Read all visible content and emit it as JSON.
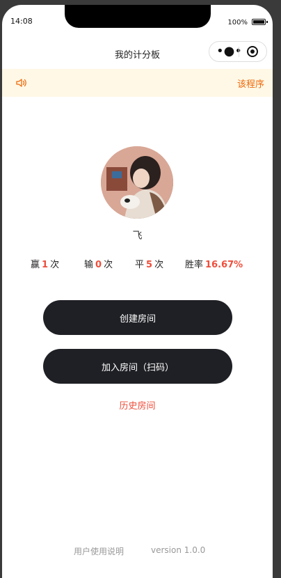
{
  "status_bar": {
    "time": "14:08",
    "battery_percent": "100%"
  },
  "nav": {
    "title": "我的计分板",
    "more_icon": "•●•",
    "close_icon": "record-icon"
  },
  "notice": {
    "text": "该程序",
    "icon": "speaker-icon",
    "color": "#ed6a0c"
  },
  "profile": {
    "username": "飞",
    "stats": [
      {
        "label": "赢",
        "value": "1",
        "suffix": "次"
      },
      {
        "label": "输",
        "value": "0",
        "suffix": "次"
      },
      {
        "label": "平",
        "value": "5",
        "suffix": "次"
      },
      {
        "label": "胜率",
        "value": "16.67%",
        "suffix": ""
      }
    ]
  },
  "actions": {
    "create_room": "创建房间",
    "join_room": "加入房间（扫码）",
    "history": "历史房间"
  },
  "footer": {
    "manual": "用户使用说明",
    "version": "version 1.0.0"
  },
  "colors": {
    "accent": "#ee4e3b",
    "button_bg": "#1f2025",
    "notice_bg": "#fff8e6"
  }
}
